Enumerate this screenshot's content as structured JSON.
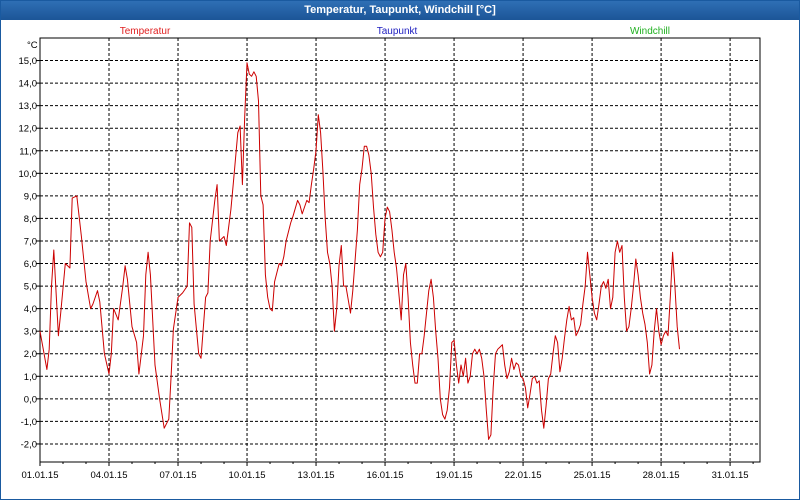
{
  "window": {
    "title": "Temperatur, Taupunkt, Windchill [°C]"
  },
  "chart_data": {
    "type": "line",
    "title": "Temperatur, Taupunkt, Windchill [°C]",
    "ylabel": "°C",
    "ylim": [
      -2.8,
      16.0
    ],
    "xlim": [
      0,
      31.3
    ],
    "grid": true,
    "yticks": [
      "15,0",
      "14,0",
      "13,0",
      "12,0",
      "11,0",
      "10,0",
      "9,0",
      "8,0",
      "7,0",
      "6,0",
      "5,0",
      "4,0",
      "3,0",
      "2,0",
      "1,0",
      "0,0",
      "-1,0",
      "-2,0"
    ],
    "xticks": [
      "01.01.15",
      "04.01.15",
      "07.01.15",
      "10.01.15",
      "13.01.15",
      "16.01.15",
      "19.01.15",
      "22.01.15",
      "25.01.15",
      "28.01.15",
      "31.01.15"
    ],
    "legend": [
      {
        "name": "Temperatur",
        "color": "#e02020"
      },
      {
        "name": "Taupunkt",
        "color": "#2020c0"
      },
      {
        "name": "Windchill",
        "color": "#20b020"
      }
    ],
    "series": [
      {
        "name": "Temperatur",
        "color": "#cc0000",
        "points": [
          [
            0.0,
            3.0
          ],
          [
            0.3,
            1.3
          ],
          [
            0.4,
            2.2
          ],
          [
            0.5,
            5.0
          ],
          [
            0.6,
            6.6
          ],
          [
            0.8,
            2.8
          ],
          [
            0.9,
            3.8
          ],
          [
            1.1,
            6.0
          ],
          [
            1.3,
            5.8
          ],
          [
            1.4,
            8.9
          ],
          [
            1.6,
            9.0
          ],
          [
            1.8,
            7.2
          ],
          [
            2.0,
            5.2
          ],
          [
            2.2,
            4.0
          ],
          [
            2.3,
            4.2
          ],
          [
            2.5,
            4.8
          ],
          [
            2.6,
            4.3
          ],
          [
            2.8,
            2.0
          ],
          [
            3.0,
            1.1
          ],
          [
            3.1,
            2.0
          ],
          [
            3.2,
            4.0
          ],
          [
            3.4,
            3.5
          ],
          [
            3.6,
            5.0
          ],
          [
            3.7,
            5.9
          ],
          [
            3.8,
            5.3
          ],
          [
            4.0,
            3.2
          ],
          [
            4.2,
            2.5
          ],
          [
            4.3,
            1.1
          ],
          [
            4.5,
            2.8
          ],
          [
            4.6,
            5.5
          ],
          [
            4.7,
            6.5
          ],
          [
            4.8,
            5.5
          ],
          [
            5.0,
            1.5
          ],
          [
            5.2,
            0.0
          ],
          [
            5.4,
            -1.3
          ],
          [
            5.6,
            -0.9
          ],
          [
            5.7,
            1.0
          ],
          [
            5.8,
            3.1
          ],
          [
            6.0,
            4.5
          ],
          [
            6.2,
            4.7
          ],
          [
            6.4,
            5.0
          ],
          [
            6.5,
            7.8
          ],
          [
            6.6,
            7.6
          ],
          [
            6.7,
            4.2
          ],
          [
            6.9,
            2.0
          ],
          [
            7.0,
            1.8
          ],
          [
            7.2,
            4.5
          ],
          [
            7.3,
            4.7
          ],
          [
            7.4,
            7.0
          ],
          [
            7.6,
            8.8
          ],
          [
            7.7,
            9.5
          ],
          [
            7.8,
            7.0
          ],
          [
            8.0,
            7.2
          ],
          [
            8.1,
            6.8
          ],
          [
            8.3,
            8.4
          ],
          [
            8.4,
            9.5
          ],
          [
            8.6,
            11.8
          ],
          [
            8.7,
            12.1
          ],
          [
            8.8,
            9.5
          ],
          [
            8.9,
            12.5
          ],
          [
            9.0,
            14.9
          ],
          [
            9.1,
            14.4
          ],
          [
            9.2,
            14.3
          ],
          [
            9.3,
            14.5
          ],
          [
            9.4,
            14.3
          ],
          [
            9.5,
            13.2
          ],
          [
            9.6,
            9.0
          ],
          [
            9.7,
            8.6
          ],
          [
            9.8,
            5.5
          ],
          [
            9.9,
            4.5
          ],
          [
            10.0,
            4.0
          ],
          [
            10.1,
            3.9
          ],
          [
            10.2,
            5.2
          ],
          [
            10.4,
            6.0
          ],
          [
            10.5,
            5.9
          ],
          [
            10.6,
            6.3
          ],
          [
            10.7,
            7.0
          ],
          [
            10.9,
            7.8
          ],
          [
            11.0,
            8.1
          ],
          [
            11.2,
            8.8
          ],
          [
            11.3,
            8.6
          ],
          [
            11.4,
            8.2
          ],
          [
            11.6,
            8.8
          ],
          [
            11.7,
            8.7
          ],
          [
            11.8,
            9.5
          ],
          [
            11.9,
            10.2
          ],
          [
            12.0,
            11.0
          ],
          [
            12.1,
            12.6
          ],
          [
            12.2,
            11.8
          ],
          [
            12.3,
            10.1
          ],
          [
            12.4,
            8.0
          ],
          [
            12.5,
            6.5
          ],
          [
            12.6,
            6.0
          ],
          [
            12.7,
            5.0
          ],
          [
            12.8,
            3.0
          ],
          [
            12.9,
            4.0
          ],
          [
            13.0,
            5.9
          ],
          [
            13.1,
            6.8
          ],
          [
            13.2,
            5.0
          ],
          [
            13.3,
            5.0
          ],
          [
            13.5,
            3.8
          ],
          [
            13.6,
            4.8
          ],
          [
            13.8,
            7.5
          ],
          [
            13.9,
            9.5
          ],
          [
            14.0,
            10.2
          ],
          [
            14.1,
            11.2
          ],
          [
            14.2,
            11.2
          ],
          [
            14.3,
            10.8
          ],
          [
            14.4,
            10.0
          ],
          [
            14.5,
            8.5
          ],
          [
            14.6,
            7.3
          ],
          [
            14.7,
            6.5
          ],
          [
            14.8,
            6.3
          ],
          [
            14.9,
            6.5
          ],
          [
            15.0,
            8.0
          ],
          [
            15.1,
            8.5
          ],
          [
            15.2,
            8.3
          ],
          [
            15.3,
            7.5
          ],
          [
            15.4,
            6.5
          ],
          [
            15.5,
            5.8
          ],
          [
            15.6,
            4.7
          ],
          [
            15.7,
            3.5
          ],
          [
            15.8,
            5.5
          ],
          [
            15.9,
            6.0
          ],
          [
            16.0,
            4.5
          ],
          [
            16.1,
            2.5
          ],
          [
            16.2,
            1.5
          ],
          [
            16.3,
            0.7
          ],
          [
            16.4,
            0.7
          ],
          [
            16.5,
            2.0
          ],
          [
            16.6,
            2.0
          ],
          [
            16.7,
            2.8
          ],
          [
            16.8,
            3.8
          ],
          [
            16.9,
            4.8
          ],
          [
            17.0,
            5.3
          ],
          [
            17.1,
            4.5
          ],
          [
            17.2,
            3.0
          ],
          [
            17.3,
            1.8
          ],
          [
            17.4,
            0.0
          ],
          [
            17.5,
            -0.7
          ],
          [
            17.6,
            -0.9
          ],
          [
            17.7,
            -0.5
          ],
          [
            17.8,
            0.5
          ],
          [
            17.9,
            2.5
          ],
          [
            18.0,
            2.6
          ],
          [
            18.1,
            1.5
          ],
          [
            18.2,
            0.7
          ],
          [
            18.3,
            1.5
          ],
          [
            18.4,
            1.0
          ],
          [
            18.5,
            1.8
          ],
          [
            18.6,
            0.7
          ],
          [
            18.7,
            1.0
          ],
          [
            18.8,
            2.0
          ],
          [
            18.9,
            2.2
          ],
          [
            19.0,
            2.0
          ],
          [
            19.1,
            2.2
          ],
          [
            19.2,
            1.8
          ],
          [
            19.3,
            1.0
          ],
          [
            19.4,
            -0.5
          ],
          [
            19.5,
            -1.8
          ],
          [
            19.6,
            -1.6
          ],
          [
            19.7,
            0.5
          ],
          [
            19.8,
            2.0
          ],
          [
            19.9,
            2.2
          ],
          [
            20.0,
            2.3
          ],
          [
            20.1,
            2.4
          ],
          [
            20.2,
            1.5
          ],
          [
            20.3,
            0.9
          ],
          [
            20.4,
            1.2
          ],
          [
            20.5,
            1.8
          ],
          [
            20.6,
            1.3
          ],
          [
            20.7,
            1.6
          ],
          [
            20.8,
            1.5
          ],
          [
            20.9,
            1.0
          ],
          [
            21.0,
            0.9
          ],
          [
            21.1,
            0.5
          ],
          [
            21.2,
            -0.4
          ],
          [
            21.3,
            0.2
          ],
          [
            21.4,
            0.9
          ],
          [
            21.5,
            1.0
          ],
          [
            21.6,
            0.7
          ],
          [
            21.7,
            0.8
          ],
          [
            21.8,
            -0.5
          ],
          [
            21.9,
            -1.3
          ],
          [
            22.0,
            -0.3
          ],
          [
            22.1,
            0.9
          ],
          [
            22.2,
            1.1
          ],
          [
            22.3,
            2.0
          ],
          [
            22.4,
            2.8
          ],
          [
            22.5,
            2.5
          ],
          [
            22.6,
            1.2
          ],
          [
            22.7,
            1.8
          ],
          [
            22.8,
            2.7
          ],
          [
            22.9,
            3.5
          ],
          [
            23.0,
            4.1
          ],
          [
            23.1,
            3.5
          ],
          [
            23.2,
            3.6
          ],
          [
            23.3,
            2.8
          ],
          [
            23.4,
            3.0
          ],
          [
            23.5,
            3.3
          ],
          [
            23.6,
            4.2
          ],
          [
            23.7,
            5.0
          ],
          [
            23.8,
            6.5
          ],
          [
            23.9,
            5.5
          ],
          [
            24.0,
            4.5
          ],
          [
            24.1,
            3.8
          ],
          [
            24.2,
            3.5
          ],
          [
            24.3,
            4.2
          ],
          [
            24.4,
            5.0
          ],
          [
            24.5,
            5.2
          ],
          [
            24.6,
            4.9
          ],
          [
            24.7,
            5.3
          ],
          [
            24.8,
            4.0
          ],
          [
            24.9,
            4.5
          ],
          [
            25.0,
            6.5
          ],
          [
            25.1,
            7.0
          ],
          [
            25.2,
            6.5
          ],
          [
            25.3,
            6.8
          ],
          [
            25.4,
            4.5
          ],
          [
            25.5,
            3.0
          ],
          [
            25.6,
            3.2
          ],
          [
            25.7,
            4.0
          ],
          [
            25.8,
            5.0
          ],
          [
            25.9,
            6.2
          ],
          [
            26.0,
            5.5
          ],
          [
            26.1,
            4.5
          ],
          [
            26.2,
            3.8
          ],
          [
            26.3,
            3.3
          ],
          [
            26.4,
            2.5
          ],
          [
            26.5,
            1.1
          ],
          [
            26.6,
            1.5
          ],
          [
            26.7,
            3.0
          ],
          [
            26.8,
            4.0
          ],
          [
            26.9,
            3.0
          ],
          [
            27.0,
            2.4
          ],
          [
            27.1,
            2.8
          ],
          [
            27.2,
            3.0
          ],
          [
            27.3,
            2.8
          ],
          [
            27.4,
            4.5
          ],
          [
            27.5,
            6.5
          ],
          [
            27.6,
            5.0
          ],
          [
            27.7,
            3.2
          ],
          [
            27.8,
            2.2
          ]
        ]
      }
    ]
  }
}
